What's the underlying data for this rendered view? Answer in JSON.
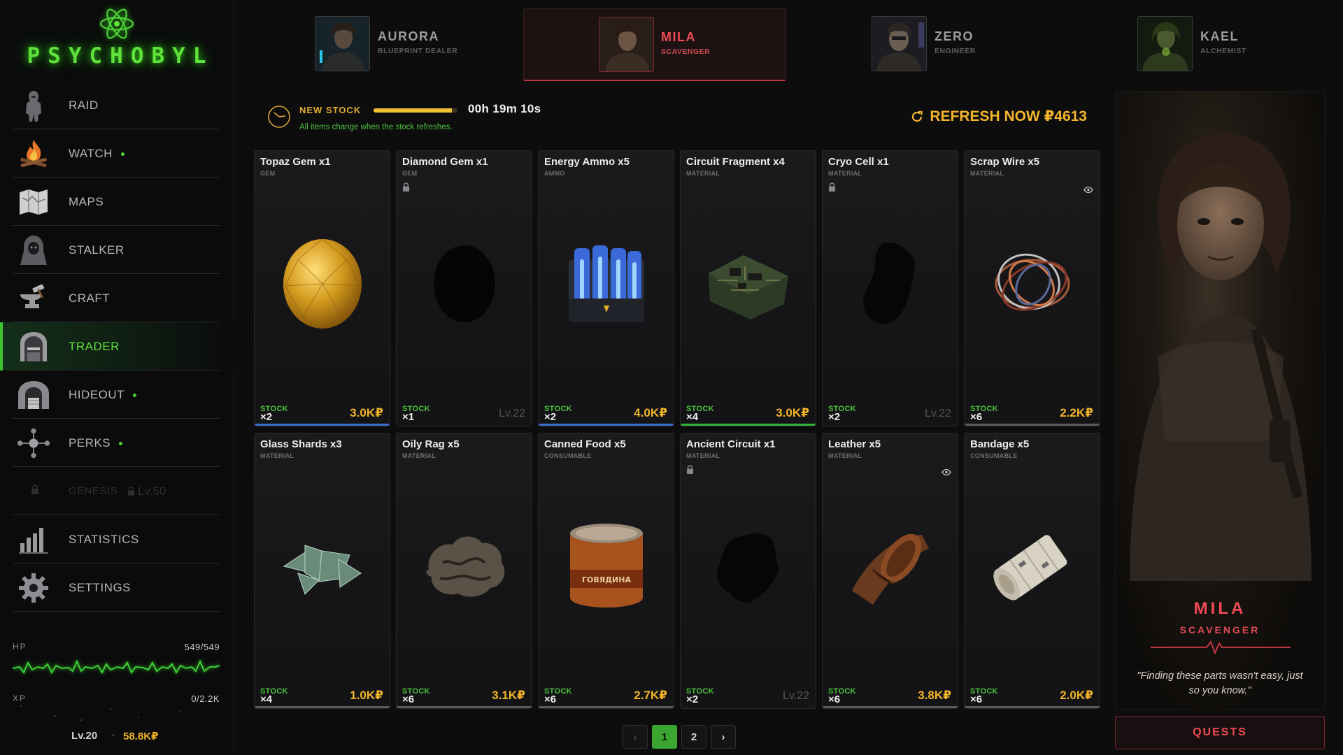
{
  "app": {
    "logo_text": "PSYCHOBYL"
  },
  "nav": [
    {
      "label": "RAID",
      "icon": "raid-icon",
      "dot": false
    },
    {
      "label": "WATCH",
      "icon": "campfire-icon",
      "dot": true
    },
    {
      "label": "MAPS",
      "icon": "map-icon",
      "dot": false
    },
    {
      "label": "STALKER",
      "icon": "stalker-icon",
      "dot": false
    },
    {
      "label": "CRAFT",
      "icon": "anvil-icon",
      "dot": false
    },
    {
      "label": "TRADER",
      "icon": "trader-icon",
      "dot": false,
      "active": true
    },
    {
      "label": "HIDEOUT",
      "icon": "hideout-icon",
      "dot": true
    },
    {
      "label": "PERKS",
      "icon": "perks-icon",
      "dot": true
    },
    {
      "label": "GENESIS",
      "icon": "lock-icon",
      "locked": true,
      "level": "Lv.50"
    },
    {
      "label": "STATISTICS",
      "icon": "statistics-icon",
      "dot": false
    },
    {
      "label": "SETTINGS",
      "icon": "gear-icon",
      "dot": false
    }
  ],
  "player": {
    "hp_label": "HP",
    "hp_value": "549/549",
    "xp_label": "XP",
    "xp_value": "0/2.2K",
    "level": "Lv.20",
    "separator": "·",
    "money": "58.8K₽"
  },
  "traders": [
    {
      "name": "AURORA",
      "role": "BLUEPRINT DEALER",
      "active": false
    },
    {
      "name": "MILA",
      "role": "SCAVENGER",
      "active": true
    },
    {
      "name": "ZERO",
      "role": "ENGINEER",
      "active": false
    },
    {
      "name": "KAEL",
      "role": "ALCHEMIST",
      "active": false
    }
  ],
  "stock": {
    "label": "NEW STOCK",
    "progress": 0.93,
    "timer": "00h 19m 10s",
    "subtitle": "All items change when the stock refreshes.",
    "refresh_label": "REFRESH NOW ₽4613"
  },
  "items": [
    {
      "name": "Topaz Gem x1",
      "category": "GEM",
      "stock_label": "STOCK",
      "qty": "×2",
      "price": "3.0K₽",
      "rarity": "#3a6fd0",
      "art": "topaz-gem"
    },
    {
      "name": "Diamond Gem x1",
      "category": "GEM",
      "stock_label": "STOCK",
      "qty": "×1",
      "locked": true,
      "req_level": "Lv.22",
      "art": "diamond-silhouette"
    },
    {
      "name": "Energy Ammo x5",
      "category": "AMMO",
      "stock_label": "STOCK",
      "qty": "×2",
      "price": "4.0K₽",
      "rarity": "#3a6fd0",
      "art": "energy-ammo"
    },
    {
      "name": "Circuit Fragment x4",
      "category": "MATERIAL",
      "stock_label": "STOCK",
      "qty": "×4",
      "price": "3.0K₽",
      "rarity": "#36b23a",
      "art": "circuit-fragment"
    },
    {
      "name": "Cryo Cell x1",
      "category": "MATERIAL",
      "stock_label": "STOCK",
      "qty": "×2",
      "locked": true,
      "req_level": "Lv.22",
      "art": "cryo-silhouette"
    },
    {
      "name": "Scrap Wire x5",
      "category": "MATERIAL",
      "stock_label": "STOCK",
      "qty": "×6",
      "price": "2.2K₽",
      "rarity": "#5a5a5e",
      "eye": true,
      "art": "scrap-wire"
    },
    {
      "name": "Glass Shards x3",
      "category": "MATERIAL",
      "stock_label": "STOCK",
      "qty": "×4",
      "price": "1.0K₽",
      "rarity": "#5a5a5e",
      "art": "glass-shards"
    },
    {
      "name": "Oily Rag x5",
      "category": "MATERIAL",
      "stock_label": "STOCK",
      "qty": "×6",
      "price": "3.1K₽",
      "rarity": "#5a5a5e",
      "art": "oily-rag"
    },
    {
      "name": "Canned Food x5",
      "category": "CONSUMABLE",
      "stock_label": "STOCK",
      "qty": "×6",
      "price": "2.7K₽",
      "rarity": "#5a5a5e",
      "art": "canned-food",
      "can_text": "ГОВЯДИНА"
    },
    {
      "name": "Ancient Circuit x1",
      "category": "MATERIAL",
      "stock_label": "STOCK",
      "qty": "×2",
      "locked": true,
      "req_level": "Lv.22",
      "art": "ancient-silhouette"
    },
    {
      "name": "Leather x5",
      "category": "MATERIAL",
      "stock_label": "STOCK",
      "qty": "×6",
      "price": "3.8K₽",
      "rarity": "#5a5a5e",
      "eye": true,
      "art": "leather"
    },
    {
      "name": "Bandage x5",
      "category": "CONSUMABLE",
      "stock_label": "STOCK",
      "qty": "×6",
      "price": "2.0K₽",
      "rarity": "#5a5a5e",
      "art": "bandage"
    }
  ],
  "pager": {
    "prev": "‹",
    "pages": [
      "1",
      "2"
    ],
    "current": "1",
    "next": "›"
  },
  "trader_panel": {
    "name": "MILA",
    "role": "SCAVENGER",
    "quote": "\"Finding these parts wasn't easy, just so you know.\"",
    "quests_label": "QUESTS"
  },
  "colors": {
    "accent_green": "#5fe03a",
    "accent_red": "#ef4a55",
    "money_gold": "#f2b52a"
  }
}
